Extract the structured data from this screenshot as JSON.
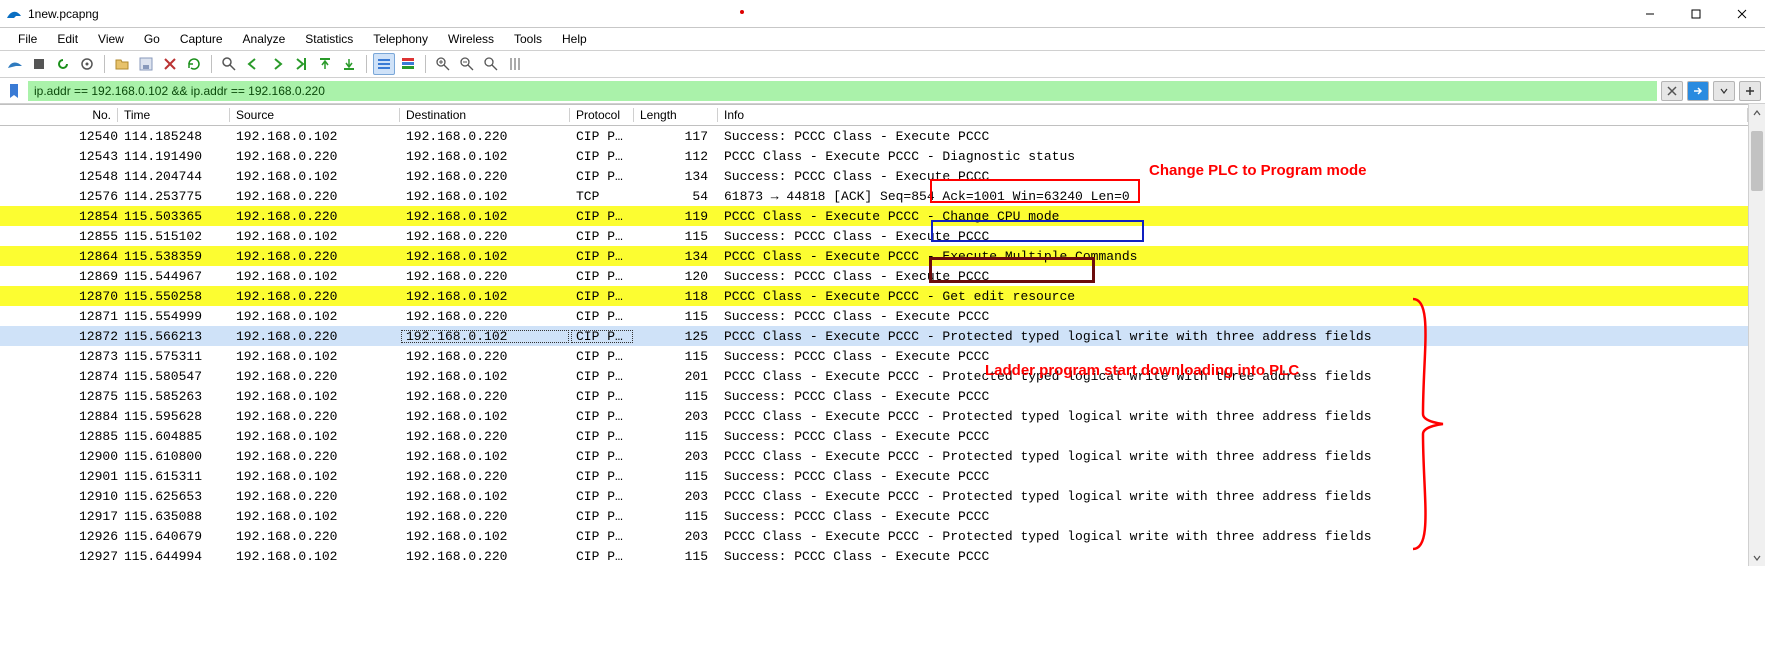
{
  "window": {
    "title": "1new.pcapng",
    "minimize_tooltip": "Minimize",
    "maximize_tooltip": "Maximize",
    "close_tooltip": "Close"
  },
  "menu": [
    "File",
    "Edit",
    "View",
    "Go",
    "Capture",
    "Analyze",
    "Statistics",
    "Telephony",
    "Wireless",
    "Tools",
    "Help"
  ],
  "filter": {
    "value": "ip.addr == 192.168.0.102 && ip.addr == 192.168.0.220"
  },
  "columns": {
    "no": "No.",
    "time": "Time",
    "source": "Source",
    "destination": "Destination",
    "protocol": "Protocol",
    "length": "Length",
    "info": "Info"
  },
  "packets": [
    {
      "no": "12540",
      "time": "114.185248",
      "src": "192.168.0.102",
      "dst": "192.168.0.220",
      "proto": "CIP PC…",
      "len": "117",
      "info": "Success: PCCC Class - Execute PCCC",
      "hl": false
    },
    {
      "no": "12543",
      "time": "114.191490",
      "src": "192.168.0.220",
      "dst": "192.168.0.102",
      "proto": "CIP PC…",
      "len": "112",
      "info": "PCCC Class - Execute PCCC - Diagnostic status",
      "hl": false
    },
    {
      "no": "12548",
      "time": "114.204744",
      "src": "192.168.0.102",
      "dst": "192.168.0.220",
      "proto": "CIP PC…",
      "len": "134",
      "info": "Success: PCCC Class - Execute PCCC",
      "hl": false
    },
    {
      "no": "12576",
      "time": "114.253775",
      "src": "192.168.0.220",
      "dst": "192.168.0.102",
      "proto": "TCP",
      "len": "54",
      "info": "61873 → 44818 [ACK] Seq=854 Ack=1001 Win=63240 Len=0",
      "hl": false
    },
    {
      "no": "12854",
      "time": "115.503365",
      "src": "192.168.0.220",
      "dst": "192.168.0.102",
      "proto": "CIP PC…",
      "len": "119",
      "info": "PCCC Class - Execute PCCC - Change CPU mode",
      "hl": true
    },
    {
      "no": "12855",
      "time": "115.515102",
      "src": "192.168.0.102",
      "dst": "192.168.0.220",
      "proto": "CIP PC…",
      "len": "115",
      "info": "Success: PCCC Class - Execute PCCC",
      "hl": false
    },
    {
      "no": "12864",
      "time": "115.538359",
      "src": "192.168.0.220",
      "dst": "192.168.0.102",
      "proto": "CIP PC…",
      "len": "134",
      "info": "PCCC Class - Execute PCCC - Execute Multiple Commands",
      "hl": true
    },
    {
      "no": "12869",
      "time": "115.544967",
      "src": "192.168.0.102",
      "dst": "192.168.0.220",
      "proto": "CIP PC…",
      "len": "120",
      "info": "Success: PCCC Class - Execute PCCC",
      "hl": false
    },
    {
      "no": "12870",
      "time": "115.550258",
      "src": "192.168.0.220",
      "dst": "192.168.0.102",
      "proto": "CIP PC…",
      "len": "118",
      "info": "PCCC Class - Execute PCCC - Get edit resource",
      "hl": true
    },
    {
      "no": "12871",
      "time": "115.554999",
      "src": "192.168.0.102",
      "dst": "192.168.0.220",
      "proto": "CIP PC…",
      "len": "115",
      "info": "Success: PCCC Class - Execute PCCC",
      "hl": false
    },
    {
      "no": "12872",
      "time": "115.566213",
      "src": "192.168.0.220",
      "dst": "192.168.0.102",
      "proto": "CIP PC…",
      "len": "125",
      "info": "PCCC Class - Execute PCCC - Protected typed logical write with three address fields",
      "hl": true,
      "sel": true
    },
    {
      "no": "12873",
      "time": "115.575311",
      "src": "192.168.0.102",
      "dst": "192.168.0.220",
      "proto": "CIP PC…",
      "len": "115",
      "info": "Success: PCCC Class - Execute PCCC",
      "hl": false
    },
    {
      "no": "12874",
      "time": "115.580547",
      "src": "192.168.0.220",
      "dst": "192.168.0.102",
      "proto": "CIP PC…",
      "len": "201",
      "info": "PCCC Class - Execute PCCC - Protected typed logical write with three address fields",
      "hl": false
    },
    {
      "no": "12875",
      "time": "115.585263",
      "src": "192.168.0.102",
      "dst": "192.168.0.220",
      "proto": "CIP PC…",
      "len": "115",
      "info": "Success: PCCC Class - Execute PCCC",
      "hl": false
    },
    {
      "no": "12884",
      "time": "115.595628",
      "src": "192.168.0.220",
      "dst": "192.168.0.102",
      "proto": "CIP PC…",
      "len": "203",
      "info": "PCCC Class - Execute PCCC - Protected typed logical write with three address fields",
      "hl": false
    },
    {
      "no": "12885",
      "time": "115.604885",
      "src": "192.168.0.102",
      "dst": "192.168.0.220",
      "proto": "CIP PC…",
      "len": "115",
      "info": "Success: PCCC Class - Execute PCCC",
      "hl": false
    },
    {
      "no": "12900",
      "time": "115.610800",
      "src": "192.168.0.220",
      "dst": "192.168.0.102",
      "proto": "CIP PC…",
      "len": "203",
      "info": "PCCC Class - Execute PCCC - Protected typed logical write with three address fields",
      "hl": false
    },
    {
      "no": "12901",
      "time": "115.615311",
      "src": "192.168.0.102",
      "dst": "192.168.0.220",
      "proto": "CIP PC…",
      "len": "115",
      "info": "Success: PCCC Class - Execute PCCC",
      "hl": false
    },
    {
      "no": "12910",
      "time": "115.625653",
      "src": "192.168.0.220",
      "dst": "192.168.0.102",
      "proto": "CIP PC…",
      "len": "203",
      "info": "PCCC Class - Execute PCCC - Protected typed logical write with three address fields",
      "hl": false
    },
    {
      "no": "12917",
      "time": "115.635088",
      "src": "192.168.0.102",
      "dst": "192.168.0.220",
      "proto": "CIP PC…",
      "len": "115",
      "info": "Success: PCCC Class - Execute PCCC",
      "hl": false
    },
    {
      "no": "12926",
      "time": "115.640679",
      "src": "192.168.0.220",
      "dst": "192.168.0.102",
      "proto": "CIP PC…",
      "len": "203",
      "info": "PCCC Class - Execute PCCC - Protected typed logical write with three address fields",
      "hl": false
    },
    {
      "no": "12927",
      "time": "115.644994",
      "src": "192.168.0.102",
      "dst": "192.168.0.220",
      "proto": "CIP PC…",
      "len": "115",
      "info": "Success: PCCC Class - Execute PCCC",
      "hl": false
    }
  ],
  "annotations": {
    "change_mode": "Change PLC to Program mode",
    "download": "Ladder program start downloading into PLC",
    "box1_label": "Change CPU mode",
    "box2_label": "Execute Multiple Commands",
    "box3_label": "Get edit resource"
  }
}
